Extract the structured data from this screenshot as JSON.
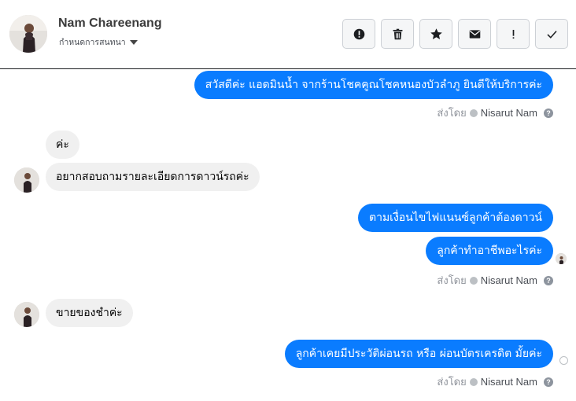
{
  "header": {
    "name": "Nam Chareenang",
    "subtitle": "กำหนดการสนทนา"
  },
  "toolbar": [
    {
      "icon": "alert-circle-icon",
      "label": "spam"
    },
    {
      "icon": "trash-icon",
      "label": "delete"
    },
    {
      "icon": "star-icon",
      "label": "star"
    },
    {
      "icon": "envelope-icon",
      "label": "mark unread"
    },
    {
      "icon": "exclamation-icon",
      "label": "follow up"
    },
    {
      "icon": "checkmark-icon",
      "label": "done"
    }
  ],
  "messages": {
    "m1": "สวัสดีค่ะ แอดมินน้ำ จากร้านโชคคูณโชคหนองบัวลำภู ยินดีให้บริการค่ะ",
    "m2": "ค่ะ",
    "m3": "อยากสอบถามรายละเอียดการดาวน์รถค่ะ",
    "m4": "ตามเงื่อนไขไฟแนนซ์ลูกค้าต้องดาวน์",
    "m5": "ลูกค้าทำอาชีพอะไรค่ะ",
    "m6": "ขายของชำค่ะ",
    "m7": "ลูกค้าเคยมีประวัติผ่อนรถ หรือ ผ่อนบัตรเครดิต มั้ยค่ะ"
  },
  "sent_by": {
    "label": "ส่งโดย",
    "name": "Nisarut Nam"
  },
  "colors": {
    "outgoing": "#0a7cff",
    "incoming": "#f0f0f0"
  }
}
